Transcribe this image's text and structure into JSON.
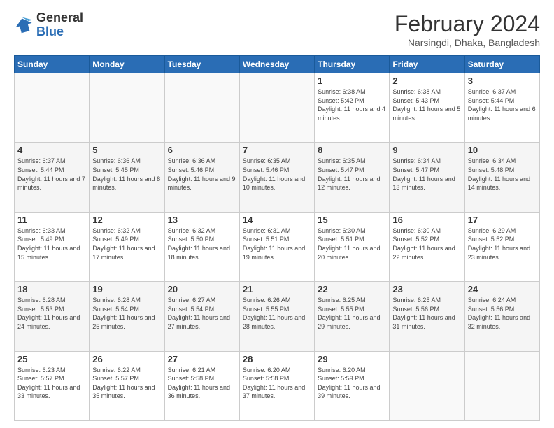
{
  "logo": {
    "general": "General",
    "blue": "Blue"
  },
  "header": {
    "title": "February 2024",
    "subtitle": "Narsingdi, Dhaka, Bangladesh"
  },
  "columns": [
    "Sunday",
    "Monday",
    "Tuesday",
    "Wednesday",
    "Thursday",
    "Friday",
    "Saturday"
  ],
  "weeks": [
    [
      {
        "day": "",
        "info": ""
      },
      {
        "day": "",
        "info": ""
      },
      {
        "day": "",
        "info": ""
      },
      {
        "day": "",
        "info": ""
      },
      {
        "day": "1",
        "info": "Sunrise: 6:38 AM\nSunset: 5:42 PM\nDaylight: 11 hours and 4 minutes."
      },
      {
        "day": "2",
        "info": "Sunrise: 6:38 AM\nSunset: 5:43 PM\nDaylight: 11 hours and 5 minutes."
      },
      {
        "day": "3",
        "info": "Sunrise: 6:37 AM\nSunset: 5:44 PM\nDaylight: 11 hours and 6 minutes."
      }
    ],
    [
      {
        "day": "4",
        "info": "Sunrise: 6:37 AM\nSunset: 5:44 PM\nDaylight: 11 hours and 7 minutes."
      },
      {
        "day": "5",
        "info": "Sunrise: 6:36 AM\nSunset: 5:45 PM\nDaylight: 11 hours and 8 minutes."
      },
      {
        "day": "6",
        "info": "Sunrise: 6:36 AM\nSunset: 5:46 PM\nDaylight: 11 hours and 9 minutes."
      },
      {
        "day": "7",
        "info": "Sunrise: 6:35 AM\nSunset: 5:46 PM\nDaylight: 11 hours and 10 minutes."
      },
      {
        "day": "8",
        "info": "Sunrise: 6:35 AM\nSunset: 5:47 PM\nDaylight: 11 hours and 12 minutes."
      },
      {
        "day": "9",
        "info": "Sunrise: 6:34 AM\nSunset: 5:47 PM\nDaylight: 11 hours and 13 minutes."
      },
      {
        "day": "10",
        "info": "Sunrise: 6:34 AM\nSunset: 5:48 PM\nDaylight: 11 hours and 14 minutes."
      }
    ],
    [
      {
        "day": "11",
        "info": "Sunrise: 6:33 AM\nSunset: 5:49 PM\nDaylight: 11 hours and 15 minutes."
      },
      {
        "day": "12",
        "info": "Sunrise: 6:32 AM\nSunset: 5:49 PM\nDaylight: 11 hours and 17 minutes."
      },
      {
        "day": "13",
        "info": "Sunrise: 6:32 AM\nSunset: 5:50 PM\nDaylight: 11 hours and 18 minutes."
      },
      {
        "day": "14",
        "info": "Sunrise: 6:31 AM\nSunset: 5:51 PM\nDaylight: 11 hours and 19 minutes."
      },
      {
        "day": "15",
        "info": "Sunrise: 6:30 AM\nSunset: 5:51 PM\nDaylight: 11 hours and 20 minutes."
      },
      {
        "day": "16",
        "info": "Sunrise: 6:30 AM\nSunset: 5:52 PM\nDaylight: 11 hours and 22 minutes."
      },
      {
        "day": "17",
        "info": "Sunrise: 6:29 AM\nSunset: 5:52 PM\nDaylight: 11 hours and 23 minutes."
      }
    ],
    [
      {
        "day": "18",
        "info": "Sunrise: 6:28 AM\nSunset: 5:53 PM\nDaylight: 11 hours and 24 minutes."
      },
      {
        "day": "19",
        "info": "Sunrise: 6:28 AM\nSunset: 5:54 PM\nDaylight: 11 hours and 25 minutes."
      },
      {
        "day": "20",
        "info": "Sunrise: 6:27 AM\nSunset: 5:54 PM\nDaylight: 11 hours and 27 minutes."
      },
      {
        "day": "21",
        "info": "Sunrise: 6:26 AM\nSunset: 5:55 PM\nDaylight: 11 hours and 28 minutes."
      },
      {
        "day": "22",
        "info": "Sunrise: 6:25 AM\nSunset: 5:55 PM\nDaylight: 11 hours and 29 minutes."
      },
      {
        "day": "23",
        "info": "Sunrise: 6:25 AM\nSunset: 5:56 PM\nDaylight: 11 hours and 31 minutes."
      },
      {
        "day": "24",
        "info": "Sunrise: 6:24 AM\nSunset: 5:56 PM\nDaylight: 11 hours and 32 minutes."
      }
    ],
    [
      {
        "day": "25",
        "info": "Sunrise: 6:23 AM\nSunset: 5:57 PM\nDaylight: 11 hours and 33 minutes."
      },
      {
        "day": "26",
        "info": "Sunrise: 6:22 AM\nSunset: 5:57 PM\nDaylight: 11 hours and 35 minutes."
      },
      {
        "day": "27",
        "info": "Sunrise: 6:21 AM\nSunset: 5:58 PM\nDaylight: 11 hours and 36 minutes."
      },
      {
        "day": "28",
        "info": "Sunrise: 6:20 AM\nSunset: 5:58 PM\nDaylight: 11 hours and 37 minutes."
      },
      {
        "day": "29",
        "info": "Sunrise: 6:20 AM\nSunset: 5:59 PM\nDaylight: 11 hours and 39 minutes."
      },
      {
        "day": "",
        "info": ""
      },
      {
        "day": "",
        "info": ""
      }
    ]
  ]
}
